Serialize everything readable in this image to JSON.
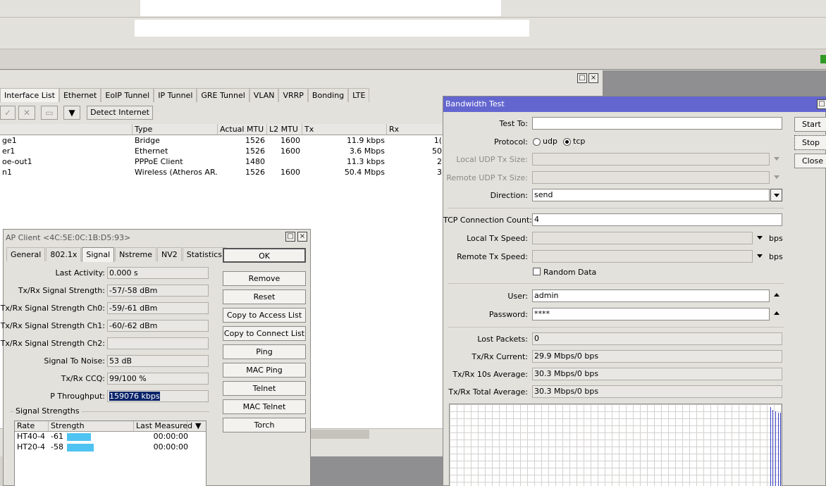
{
  "interface_window": {
    "tabs": [
      "Interface List",
      "Ethernet",
      "EoIP Tunnel",
      "IP Tunnel",
      "GRE Tunnel",
      "VLAN",
      "VRRP",
      "Bonding",
      "LTE"
    ],
    "detect_internet_label": "Detect Internet",
    "columns": [
      "Type",
      "Actual MTU",
      "L2 MTU",
      "Tx",
      "Rx"
    ],
    "rows": [
      {
        "name": "ge1",
        "type": "Bridge",
        "mtu": "1526",
        "l2mtu": "1600",
        "tx": "11.9 kbps",
        "rx": "1("
      },
      {
        "name": "er1",
        "type": "Ethernet",
        "mtu": "1526",
        "l2mtu": "1600",
        "tx": "3.6 Mbps",
        "rx": "50"
      },
      {
        "name": "oe-out1",
        "type": "PPPoE Client",
        "mtu": "1480",
        "l2mtu": "",
        "tx": "11.3 kbps",
        "rx": "2"
      },
      {
        "name": "n1",
        "type": "Wireless (Atheros AR...",
        "mtu": "1526",
        "l2mtu": "1600",
        "tx": "50.4 Mbps",
        "rx": "3"
      }
    ]
  },
  "ap_client": {
    "title": "AP Client <4C:5E:0C:1B:D5:93>",
    "tabs": [
      "General",
      "802.1x",
      "Signal",
      "Nstreme",
      "NV2",
      "Statistics"
    ],
    "fields": [
      {
        "label": "Last Activity:",
        "value": "0.000 s"
      },
      {
        "label": "Tx/Rx Signal Strength:",
        "value": "-57/-58 dBm"
      },
      {
        "label": "Tx/Rx Signal Strength Ch0:",
        "value": "-59/-61 dBm"
      },
      {
        "label": "Tx/Rx Signal Strength Ch1:",
        "value": "-60/-62 dBm"
      },
      {
        "label": "Tx/Rx Signal Strength Ch2:",
        "value": ""
      },
      {
        "label": "Signal To Noise:",
        "value": "53 dB"
      },
      {
        "label": "Tx/Rx CCQ:",
        "value": "99/100 %"
      },
      {
        "label": "P Throughput:",
        "value": "159076 kbps"
      }
    ],
    "buttons": [
      "OK",
      "Remove",
      "Reset",
      "Copy to Access List",
      "Copy to Connect List",
      "Ping",
      "MAC Ping",
      "Telnet",
      "MAC Telnet",
      "Torch"
    ],
    "signal_strengths_label": "Signal Strengths",
    "signal_columns": [
      "Rate",
      "Strength",
      "Last Measured"
    ],
    "signal_rows": [
      {
        "rate": "HT40-4",
        "strength": "-61",
        "last": "00:00:00",
        "bar_level": 0.85
      },
      {
        "rate": "HT20-4",
        "strength": "-58",
        "last": "00:00:00",
        "bar_level": 0.95
      }
    ]
  },
  "bandwidth_test": {
    "title": "Bandwidth Test",
    "test_to_label": "Test To:",
    "test_to_value": "",
    "protocol_label": "Protocol:",
    "protocol_udp": "udp",
    "protocol_tcp": "tcp",
    "protocol_selected": "tcp",
    "local_udp_label": "Local UDP Tx Size:",
    "remote_udp_label": "Remote UDP Tx Size:",
    "direction_label": "Direction:",
    "direction_value": "send",
    "tcp_count_label": "TCP Connection Count:",
    "tcp_count_value": "4",
    "local_speed_label": "Local Tx Speed:",
    "remote_speed_label": "Remote Tx Speed:",
    "bps": "bps",
    "random_data_label": "Random Data",
    "user_label": "User:",
    "user_value": "admin",
    "password_label": "Password:",
    "password_value": "****",
    "lost_packets_label": "Lost Packets:",
    "lost_packets_value": "0",
    "current_label": "Tx/Rx Current:",
    "current_value": "29.9 Mbps/0 bps",
    "avg10_label": "Tx/Rx 10s Average:",
    "avg10_value": "30.3 Mbps/0 bps",
    "total_label": "Tx/Rx Total Average:",
    "total_value": "30.3 Mbps/0 bps",
    "buttons": [
      "Start",
      "Stop",
      "Close"
    ]
  }
}
